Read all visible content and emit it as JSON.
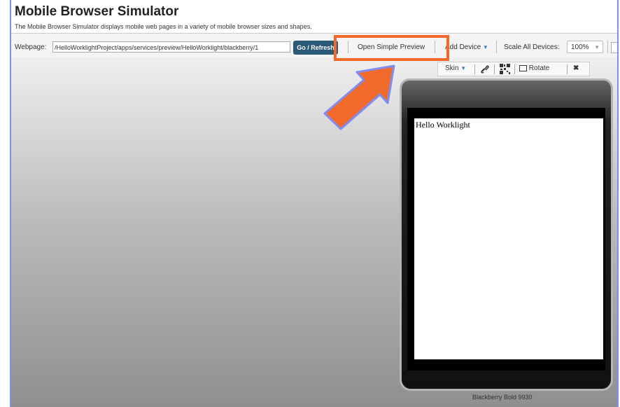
{
  "header": {
    "title": "Mobile Browser Simulator",
    "subtitle": "The Mobile Browser Simulator displays mobile web pages in a variety of mobile browser sizes and shapes."
  },
  "toolbar": {
    "webpage_label": "Webpage:",
    "url_value": "/HelloWorklightProject/apps/services/preview/HelloWorklight/blackberry/1",
    "go_label": "Go / Refresh",
    "simple_preview_label": "Open Simple Preview",
    "add_device_label": "Add Device",
    "scale_label": "Scale All Devices:",
    "scale_value": "100%"
  },
  "device_toolbar": {
    "skin_label": "Skin",
    "rotate_label": "Rotate"
  },
  "device": {
    "content_text": "Hello Worklight",
    "name": "Blackberry Bold 9930"
  },
  "annotation": {
    "arrow_color": "#f26a2b",
    "arrow_outline_color": "#7f8cf0",
    "box_color": "#f26a2b"
  }
}
